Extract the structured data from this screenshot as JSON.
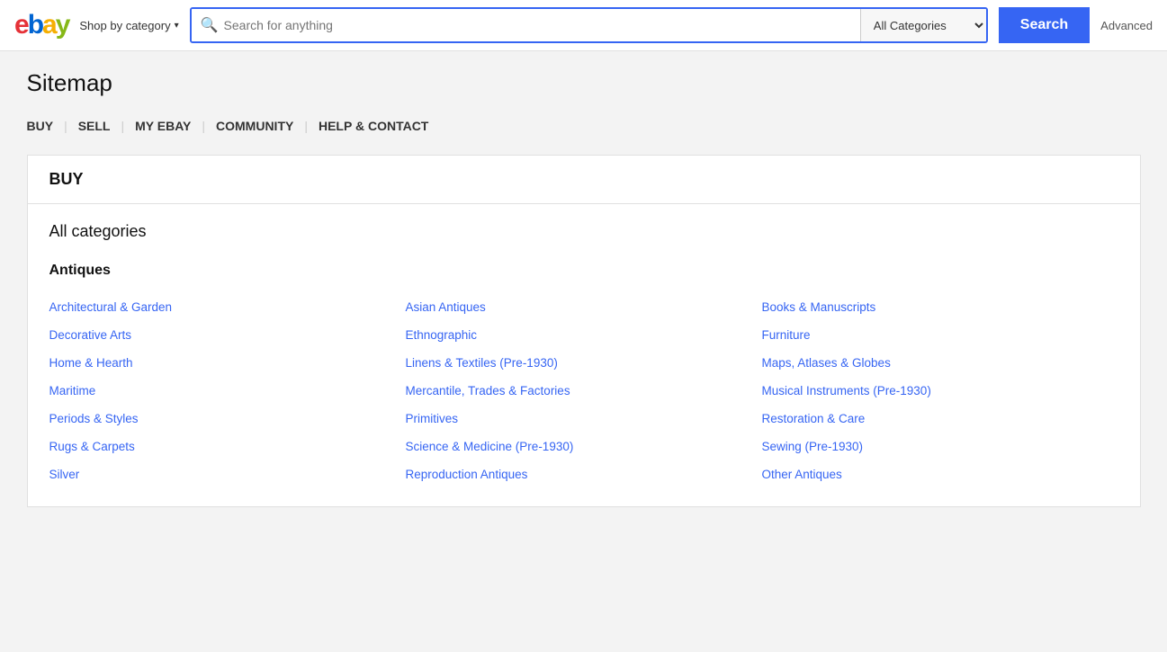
{
  "header": {
    "logo_text": "ebay",
    "shop_by_category": "Shop by category",
    "search_placeholder": "Search for anything",
    "category_default": "All Categories",
    "search_button_label": "Search",
    "advanced_label": "Advanced"
  },
  "sitemap": {
    "page_title": "Sitemap",
    "nav_items": [
      {
        "label": "BUY",
        "id": "buy"
      },
      {
        "label": "SELL",
        "id": "sell"
      },
      {
        "label": "MY EBAY",
        "id": "my-ebay"
      },
      {
        "label": "COMMUNITY",
        "id": "community"
      },
      {
        "label": "HELP & CONTACT",
        "id": "help"
      }
    ],
    "section_title": "BUY",
    "all_categories_label": "All categories",
    "antiques_label": "Antiques",
    "antiques_items": [
      [
        "Architectural & Garden",
        "Asian Antiques",
        "Books & Manuscripts"
      ],
      [
        "Decorative Arts",
        "Ethnographic",
        "Furniture"
      ],
      [
        "Home & Hearth",
        "Linens & Textiles (Pre-1930)",
        "Maps, Atlases & Globes"
      ],
      [
        "Maritime",
        "Mercantile, Trades & Factories",
        "Musical Instruments (Pre-1930)"
      ],
      [
        "Periods & Styles",
        "Primitives",
        "Restoration & Care"
      ],
      [
        "Rugs & Carpets",
        "Science & Medicine (Pre-1930)",
        "Sewing (Pre-1930)"
      ],
      [
        "Silver",
        "Reproduction Antiques",
        "Other Antiques"
      ]
    ]
  }
}
